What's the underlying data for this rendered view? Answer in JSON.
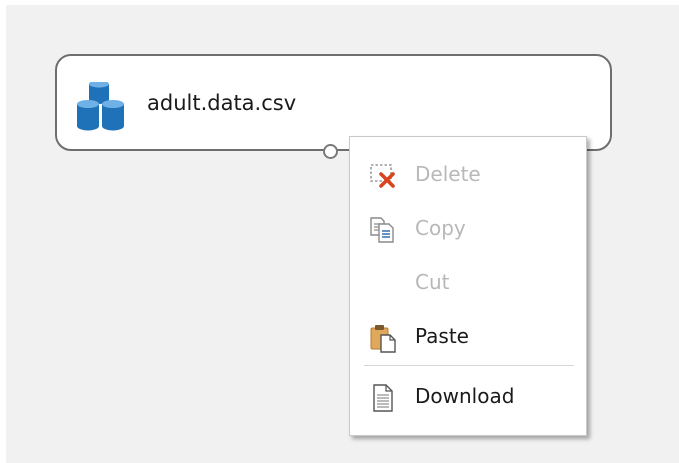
{
  "node": {
    "label": "adult.data.csv",
    "icon": "dataset-cylinders-icon",
    "icon_color": "#1f72b8"
  },
  "context_menu": {
    "items": [
      {
        "label": "Delete",
        "icon": "delete-icon",
        "enabled": false
      },
      {
        "label": "Copy",
        "icon": "copy-icon",
        "enabled": false
      },
      {
        "label": "Cut",
        "icon": "",
        "enabled": false
      },
      {
        "label": "Paste",
        "icon": "paste-icon",
        "enabled": true
      },
      {
        "label": "Download",
        "icon": "document-icon",
        "enabled": true
      }
    ]
  },
  "colors": {
    "canvas": "#f1f1f1",
    "disabled_text": "#b8b8b8",
    "delete_accent": "#d9441f",
    "paste_accent": "#e0a85a"
  }
}
